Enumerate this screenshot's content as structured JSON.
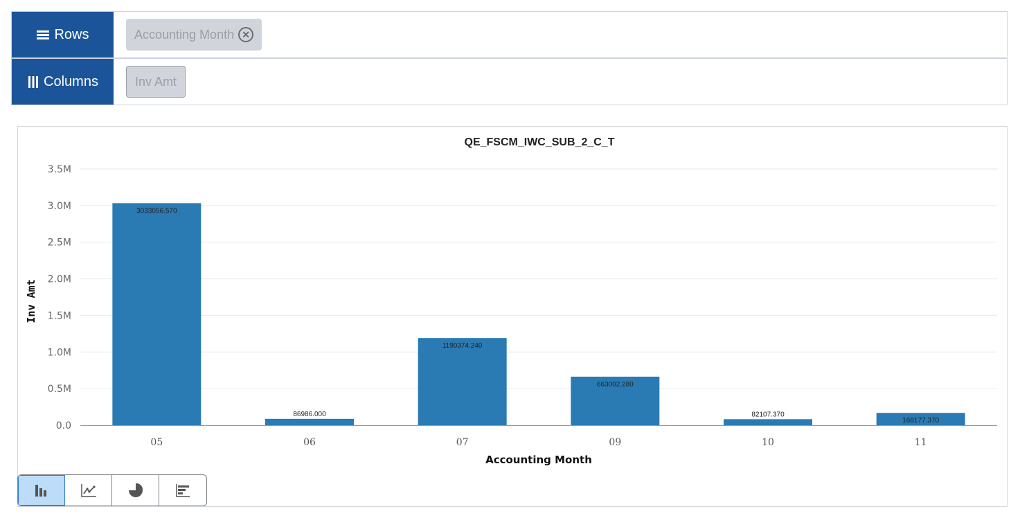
{
  "pivot": {
    "rows_label": "Rows",
    "columns_label": "Columns",
    "row_fields": [
      {
        "label": "Accounting Month",
        "removable": true
      }
    ],
    "column_fields": [
      {
        "label": "Inv Amt"
      }
    ]
  },
  "chart_toolbar": {
    "types": [
      {
        "name": "bar-chart",
        "active": true
      },
      {
        "name": "line-chart",
        "active": false
      },
      {
        "name": "pie-chart",
        "active": false
      },
      {
        "name": "horizontal-bar-chart",
        "active": false
      }
    ]
  },
  "colors": {
    "bar": "#2a7bb3",
    "header_bg": "#1c5499"
  },
  "chart_data": {
    "type": "bar",
    "title": "QE_FSCM_IWC_SUB_2_C_T",
    "xlabel": "Accounting Month",
    "ylabel": "Inv Amt",
    "categories": [
      "05",
      "06",
      "07",
      "09",
      "10",
      "11"
    ],
    "values": [
      3033056.57,
      86986.0,
      1190374.24,
      663002.28,
      82107.37,
      168177.37
    ],
    "data_labels": [
      "3033056.570",
      "86986.000",
      "1190374.240",
      "663002.280",
      "82107.370",
      "168177.370"
    ],
    "ylim": [
      0,
      3500000
    ],
    "yticks": [
      0,
      500000,
      1000000,
      1500000,
      2000000,
      2500000,
      3000000,
      3500000
    ],
    "ytick_labels": [
      "0.0",
      "0.5M",
      "1.0M",
      "1.5M",
      "2.0M",
      "2.5M",
      "3.0M",
      "3.5M"
    ],
    "grid": true,
    "legend": "none"
  }
}
